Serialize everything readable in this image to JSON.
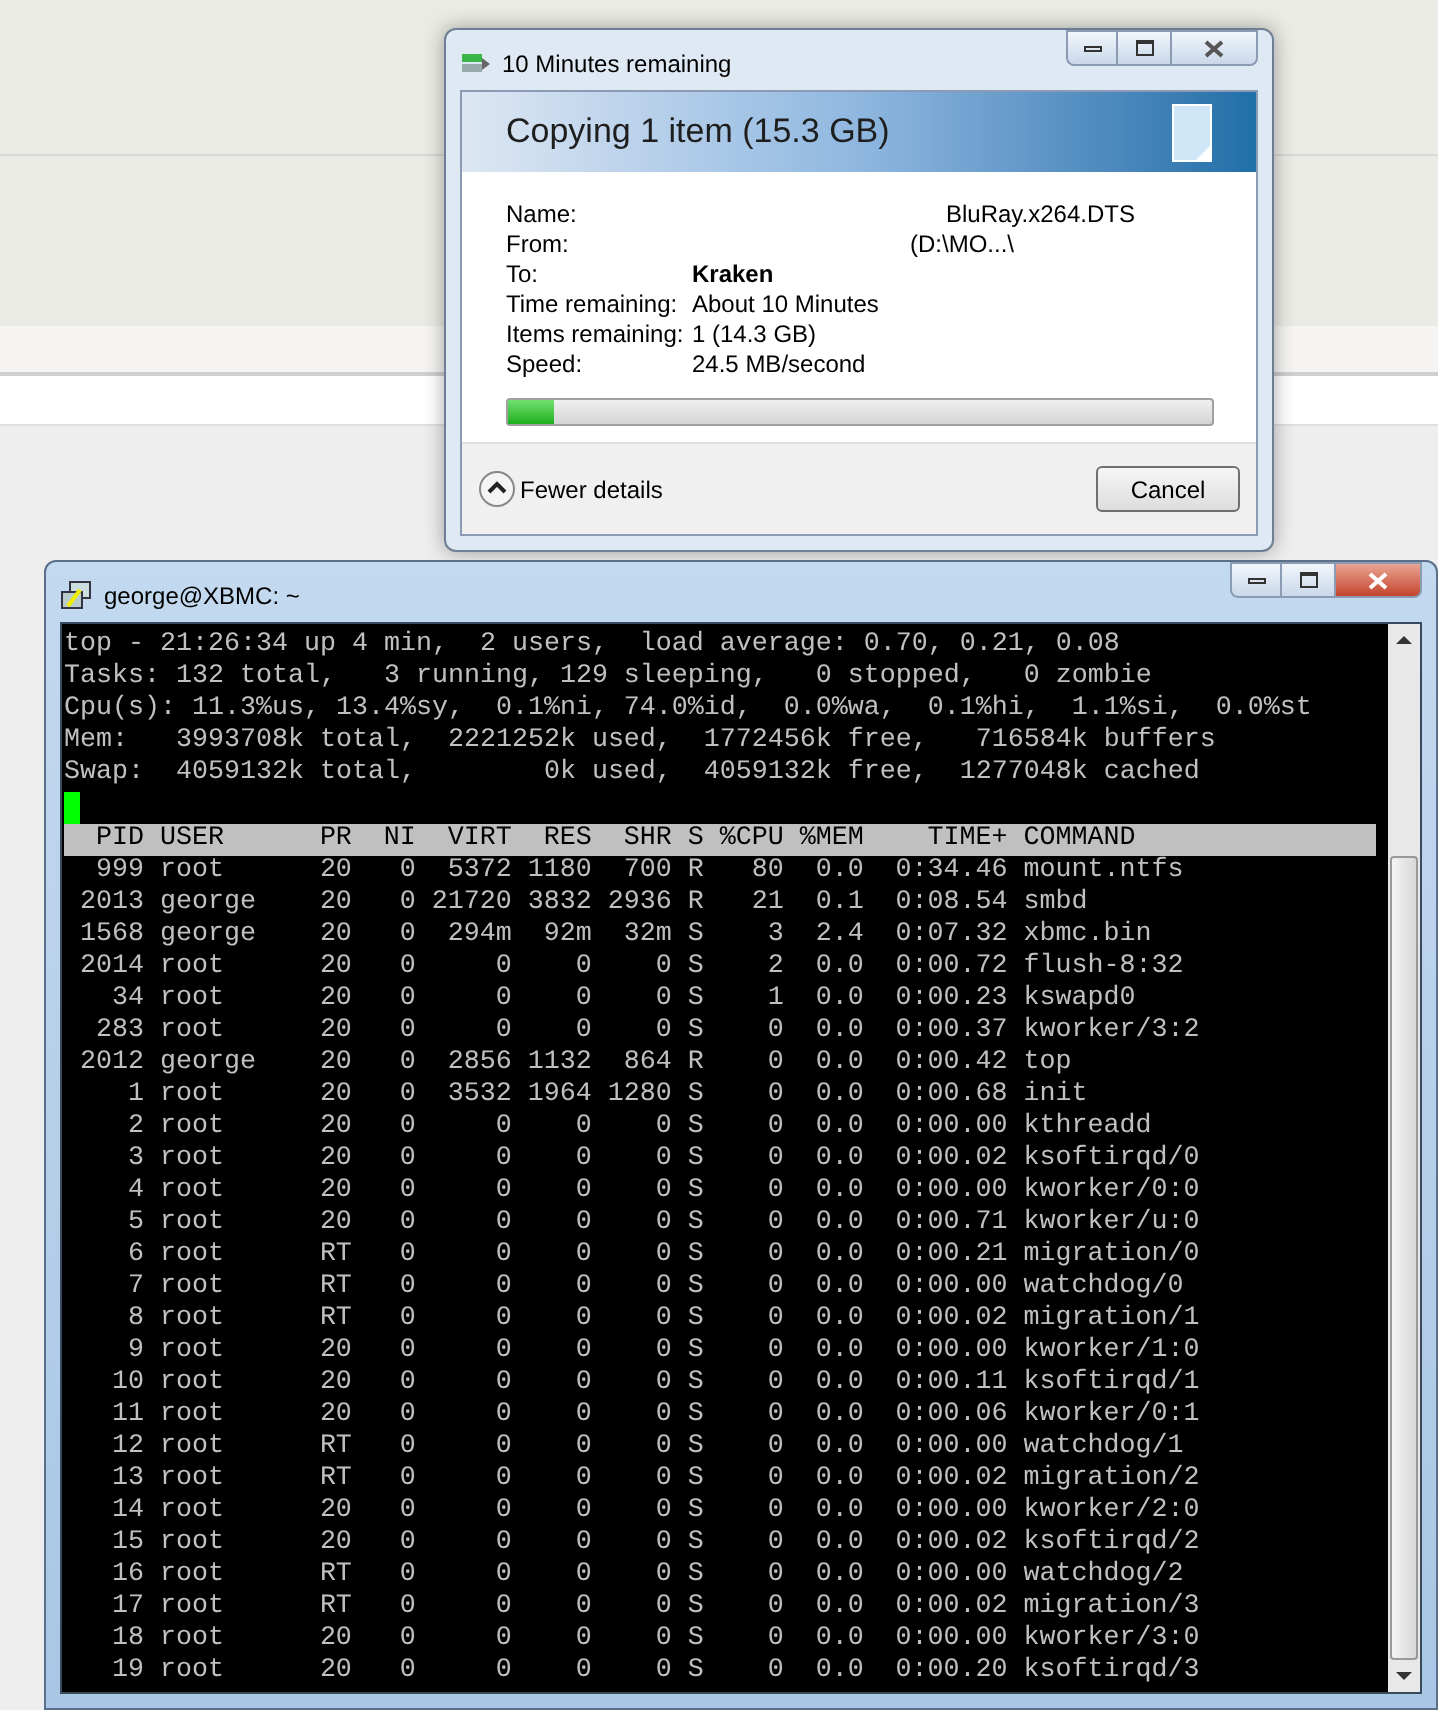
{
  "copy_dialog": {
    "title": "10 Minutes remaining",
    "heading": "Copying 1 item (15.3 GB)",
    "details": [
      {
        "label": "Name:",
        "value": "BluRay.x264.DTS",
        "kind": "shifted"
      },
      {
        "label": "From:",
        "value": "(D:\\MO...\\",
        "kind": "shifted"
      },
      {
        "label": "To:",
        "value": "Kraken",
        "kind": "bold"
      },
      {
        "label": "Time remaining:",
        "value": "About 10 Minutes",
        "kind": "plain"
      },
      {
        "label": "Items remaining:",
        "value": "1 (14.3 GB)",
        "kind": "plain"
      },
      {
        "label": "Speed:",
        "value": "24.5 MB/second",
        "kind": "plain"
      }
    ],
    "progress": {
      "level": 0.065
    },
    "toggle_label": "Fewer details",
    "cancel_label": "Cancel"
  },
  "terminal": {
    "title": "george@XBMC: ~",
    "summary": [
      "top - 21:26:34 up 4 min,  2 users,  load average: 0.70, 0.21, 0.08",
      "Tasks: 132 total,   3 running, 129 sleeping,   0 stopped,   0 zombie",
      "Cpu(s): 11.3%us, 13.4%sy,  0.1%ni, 74.0%id,  0.0%wa,  0.1%hi,  1.1%si,  0.0%st",
      "Mem:   3993708k total,  2221252k used,  1772456k free,   716584k buffers",
      "Swap:  4059132k total,        0k used,  4059132k free,  1277048k cached"
    ],
    "columns": [
      "PID",
      "USER",
      "PR",
      "NI",
      "VIRT",
      "RES",
      "SHR",
      "S",
      "%CPU",
      "%MEM",
      "TIME+",
      "COMMAND"
    ],
    "rows": [
      [
        "999",
        "root",
        "20",
        "0",
        "5372",
        "1180",
        "700",
        "R",
        "80",
        "0.0",
        "0:34.46",
        "mount.ntfs"
      ],
      [
        "2013",
        "george",
        "20",
        "0",
        "21720",
        "3832",
        "2936",
        "R",
        "21",
        "0.1",
        "0:08.54",
        "smbd"
      ],
      [
        "1568",
        "george",
        "20",
        "0",
        "294m",
        "92m",
        "32m",
        "S",
        "3",
        "2.4",
        "0:07.32",
        "xbmc.bin"
      ],
      [
        "2014",
        "root",
        "20",
        "0",
        "0",
        "0",
        "0",
        "S",
        "2",
        "0.0",
        "0:00.72",
        "flush-8:32"
      ],
      [
        "34",
        "root",
        "20",
        "0",
        "0",
        "0",
        "0",
        "S",
        "1",
        "0.0",
        "0:00.23",
        "kswapd0"
      ],
      [
        "283",
        "root",
        "20",
        "0",
        "0",
        "0",
        "0",
        "S",
        "0",
        "0.0",
        "0:00.37",
        "kworker/3:2"
      ],
      [
        "2012",
        "george",
        "20",
        "0",
        "2856",
        "1132",
        "864",
        "R",
        "0",
        "0.0",
        "0:00.42",
        "top"
      ],
      [
        "1",
        "root",
        "20",
        "0",
        "3532",
        "1964",
        "1280",
        "S",
        "0",
        "0.0",
        "0:00.68",
        "init"
      ],
      [
        "2",
        "root",
        "20",
        "0",
        "0",
        "0",
        "0",
        "S",
        "0",
        "0.0",
        "0:00.00",
        "kthreadd"
      ],
      [
        "3",
        "root",
        "20",
        "0",
        "0",
        "0",
        "0",
        "S",
        "0",
        "0.0",
        "0:00.02",
        "ksoftirqd/0"
      ],
      [
        "4",
        "root",
        "20",
        "0",
        "0",
        "0",
        "0",
        "S",
        "0",
        "0.0",
        "0:00.00",
        "kworker/0:0"
      ],
      [
        "5",
        "root",
        "20",
        "0",
        "0",
        "0",
        "0",
        "S",
        "0",
        "0.0",
        "0:00.71",
        "kworker/u:0"
      ],
      [
        "6",
        "root",
        "RT",
        "0",
        "0",
        "0",
        "0",
        "S",
        "0",
        "0.0",
        "0:00.21",
        "migration/0"
      ],
      [
        "7",
        "root",
        "RT",
        "0",
        "0",
        "0",
        "0",
        "S",
        "0",
        "0.0",
        "0:00.00",
        "watchdog/0"
      ],
      [
        "8",
        "root",
        "RT",
        "0",
        "0",
        "0",
        "0",
        "S",
        "0",
        "0.0",
        "0:00.02",
        "migration/1"
      ],
      [
        "9",
        "root",
        "20",
        "0",
        "0",
        "0",
        "0",
        "S",
        "0",
        "0.0",
        "0:00.00",
        "kworker/1:0"
      ],
      [
        "10",
        "root",
        "20",
        "0",
        "0",
        "0",
        "0",
        "S",
        "0",
        "0.0",
        "0:00.11",
        "ksoftirqd/1"
      ],
      [
        "11",
        "root",
        "20",
        "0",
        "0",
        "0",
        "0",
        "S",
        "0",
        "0.0",
        "0:00.06",
        "kworker/0:1"
      ],
      [
        "12",
        "root",
        "RT",
        "0",
        "0",
        "0",
        "0",
        "S",
        "0",
        "0.0",
        "0:00.00",
        "watchdog/1"
      ],
      [
        "13",
        "root",
        "RT",
        "0",
        "0",
        "0",
        "0",
        "S",
        "0",
        "0.0",
        "0:00.02",
        "migration/2"
      ],
      [
        "14",
        "root",
        "20",
        "0",
        "0",
        "0",
        "0",
        "S",
        "0",
        "0.0",
        "0:00.00",
        "kworker/2:0"
      ],
      [
        "15",
        "root",
        "20",
        "0",
        "0",
        "0",
        "0",
        "S",
        "0",
        "0.0",
        "0:00.02",
        "ksoftirqd/2"
      ],
      [
        "16",
        "root",
        "RT",
        "0",
        "0",
        "0",
        "0",
        "S",
        "0",
        "0.0",
        "0:00.00",
        "watchdog/2"
      ],
      [
        "17",
        "root",
        "RT",
        "0",
        "0",
        "0",
        "0",
        "S",
        "0",
        "0.0",
        "0:00.02",
        "migration/3"
      ],
      [
        "18",
        "root",
        "20",
        "0",
        "0",
        "0",
        "0",
        "S",
        "0",
        "0.0",
        "0:00.00",
        "kworker/3:0"
      ],
      [
        "19",
        "root",
        "20",
        "0",
        "0",
        "0",
        "0",
        "S",
        "0",
        "0.0",
        "0:00.20",
        "ksoftirqd/3"
      ]
    ]
  }
}
